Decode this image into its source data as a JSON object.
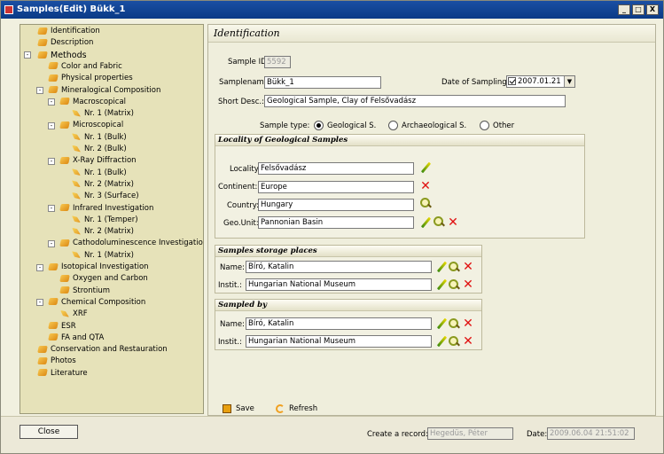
{
  "window": {
    "title": "Samples(Edit) Bükk_1",
    "min": "_",
    "max": "□",
    "close": "X"
  },
  "tree": [
    {
      "label": "Identification",
      "level": 1,
      "icon": "folder"
    },
    {
      "label": "Description",
      "level": 1,
      "icon": "folder"
    },
    {
      "label": "Methods",
      "level": 1,
      "icon": "folder",
      "toggle": "-",
      "bold": true
    },
    {
      "label": "Color and Fabric",
      "level": 2,
      "icon": "folder"
    },
    {
      "label": "Physical properties",
      "level": 2,
      "icon": "folder"
    },
    {
      "label": "Mineralogical Composition",
      "level": 2,
      "icon": "folder",
      "toggle": "-"
    },
    {
      "label": "Macroscopical",
      "level": 3,
      "icon": "folder",
      "toggle": "-"
    },
    {
      "label": "Nr. 1 (Matrix)",
      "level": 4,
      "icon": "leaf"
    },
    {
      "label": "Microscopical",
      "level": 3,
      "icon": "folder",
      "toggle": "-"
    },
    {
      "label": "Nr. 1 (Bulk)",
      "level": 4,
      "icon": "leaf"
    },
    {
      "label": "Nr. 2 (Bulk)",
      "level": 4,
      "icon": "leaf"
    },
    {
      "label": "X-Ray Diffraction",
      "level": 3,
      "icon": "folder",
      "toggle": "-"
    },
    {
      "label": "Nr. 1 (Bulk)",
      "level": 4,
      "icon": "leaf"
    },
    {
      "label": "Nr. 2 (Matrix)",
      "level": 4,
      "icon": "leaf"
    },
    {
      "label": "Nr. 3 (Surface)",
      "level": 4,
      "icon": "leaf"
    },
    {
      "label": "Infrared Investigation",
      "level": 3,
      "icon": "folder",
      "toggle": "-"
    },
    {
      "label": "Nr. 1 (Temper)",
      "level": 4,
      "icon": "leaf"
    },
    {
      "label": "Nr. 2 (Matrix)",
      "level": 4,
      "icon": "leaf"
    },
    {
      "label": "Cathodoluminescence Investigation",
      "level": 3,
      "icon": "folder",
      "toggle": "-"
    },
    {
      "label": "Nr. 1 (Matrix)",
      "level": 4,
      "icon": "leaf"
    },
    {
      "label": "Isotopical Investigation",
      "level": 2,
      "icon": "folder",
      "toggle": "-"
    },
    {
      "label": "Oxygen and Carbon",
      "level": 3,
      "icon": "folder"
    },
    {
      "label": "Strontium",
      "level": 3,
      "icon": "folder"
    },
    {
      "label": "Chemical Composition",
      "level": 2,
      "icon": "folder",
      "toggle": "-"
    },
    {
      "label": "XRF",
      "level": 3,
      "icon": "leaf"
    },
    {
      "label": "ESR",
      "level": 2,
      "icon": "folder"
    },
    {
      "label": "FA and QTA",
      "level": 2,
      "icon": "folder"
    },
    {
      "label": "Conservation and Restauration",
      "level": 1,
      "icon": "folder"
    },
    {
      "label": "Photos",
      "level": 1,
      "icon": "folder"
    },
    {
      "label": "Literature",
      "level": 1,
      "icon": "folder"
    }
  ],
  "main": {
    "header": "Identification",
    "sample_id_label": "Sample ID:",
    "sample_id_value": "5592",
    "samplename_label": "Samplename:",
    "samplename_value": "Bükk_1",
    "date_label": "Date of Sampling:",
    "date_value": "2007.01.21",
    "short_desc_label": "Short Desc.:",
    "short_desc_value": "Geological Sample, Clay of Felsővadász",
    "sample_type_label": "Sample type:",
    "sample_types": [
      "Geological S.",
      "Archaeological S.",
      "Other"
    ],
    "sample_type_selected": 0
  },
  "locality": {
    "title": "Locality of Geological Samples",
    "locality_label": "Locality:",
    "locality_value": "Felsővadász",
    "continent_label": "Continent:",
    "continent_value": "Europe",
    "country_label": "Country:",
    "country_value": "Hungary",
    "geounit_label": "Geo.Unit:",
    "geounit_value": "Pannonian Basin"
  },
  "storage": {
    "title": "Samples storage places",
    "name_label": "Name:",
    "name_value": "Bíró, Katalin",
    "instit_label": "Instit.:",
    "instit_value": "Hungarian National Museum"
  },
  "sampledby": {
    "title": "Sampled by",
    "name_label": "Name:",
    "name_value": "Bíró, Katalin",
    "instit_label": "Instit.:",
    "instit_value": "Hungarian National Museum"
  },
  "actions": {
    "save": "Save",
    "refresh": "Refresh"
  },
  "footer": {
    "close": "Close",
    "create_label": "Create a record:",
    "create_value": "Hegedüs, Péter",
    "date_label": "Date:",
    "date_value": "2009.06.04 21:51:02"
  }
}
